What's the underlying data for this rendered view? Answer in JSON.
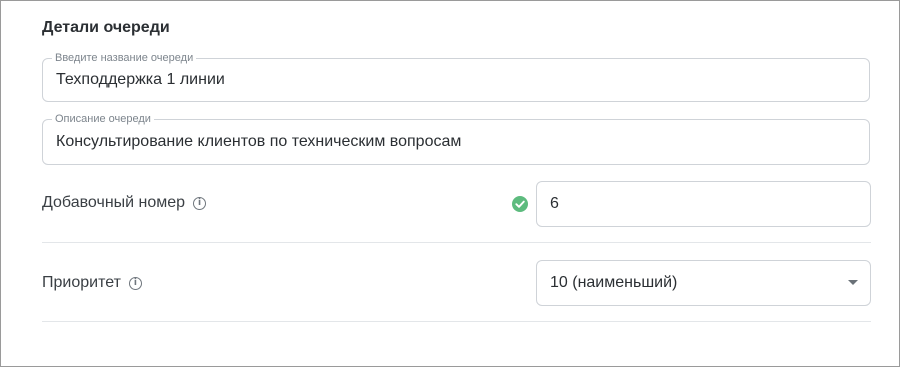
{
  "section": {
    "title": "Детали очереди"
  },
  "queue_name": {
    "label": "Введите название очереди",
    "value": "Техподдержка 1 линии"
  },
  "queue_description": {
    "label": "Описание очереди",
    "value": "Консультирование клиентов по техническим вопросам"
  },
  "extension": {
    "label": "Добавочный номер",
    "value": "6",
    "status": "valid",
    "status_color": "#5dbb7e"
  },
  "priority": {
    "label": "Приоритет",
    "selected": "10 (наименьший)"
  },
  "icons": {
    "info": "info-icon",
    "check": "check-circle-icon",
    "dropdown": "chevron-down-icon"
  }
}
